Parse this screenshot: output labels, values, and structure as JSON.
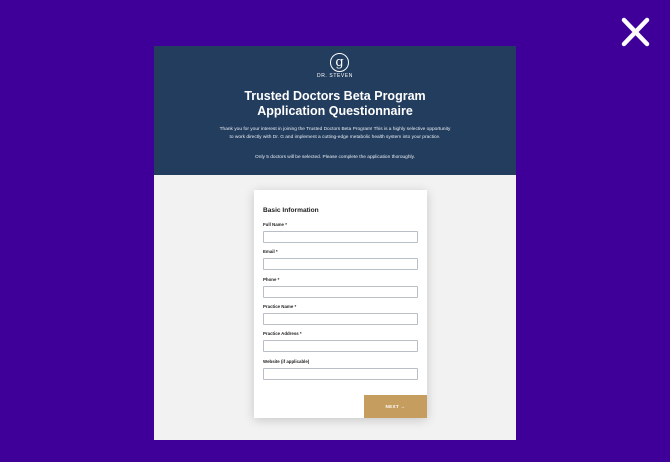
{
  "colors": {
    "background": "#3f0099",
    "hero": "#233d5e",
    "accent_gold": "#c59d5f",
    "page": "#f2f2f2"
  },
  "close_icon": "close-x-icon",
  "brand": {
    "logo_letter": "g",
    "name": "DR. STEVEN"
  },
  "hero": {
    "title_line1": "Trusted Doctors Beta Program",
    "title_line2": "Application Questionnaire",
    "description": "Thank you for your interest in joining the Trusted Doctors Beta Program! This is a highly selective opportunity to work directly with Dr. G and implement a cutting-edge metabolic health system into your practice.",
    "note": "Only 5 doctors will be selected. Please complete the application thoroughly."
  },
  "form": {
    "section_title": "Basic Information",
    "fields": [
      {
        "label": "Full Name *",
        "value": ""
      },
      {
        "label": "Email *",
        "value": ""
      },
      {
        "label": "Phone *",
        "value": ""
      },
      {
        "label": "Practice Name *",
        "value": ""
      },
      {
        "label": "Practice Address *",
        "value": ""
      },
      {
        "label": "Website (if applicable)",
        "value": ""
      }
    ],
    "next_label": "NEXT →"
  }
}
